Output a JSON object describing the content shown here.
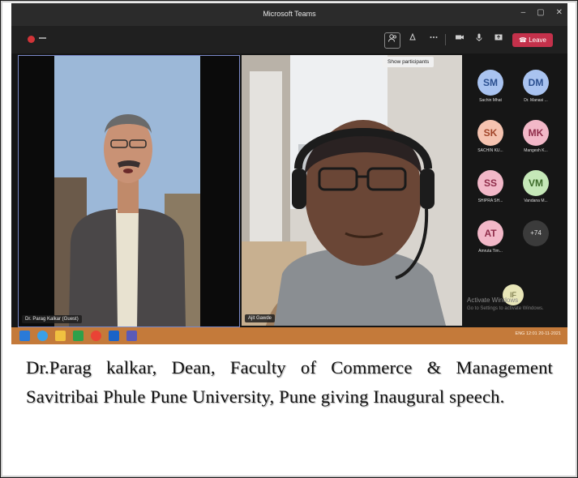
{
  "window": {
    "title": "Microsoft Teams",
    "controls": [
      "–",
      "▢",
      "✕"
    ]
  },
  "toolbar": {
    "show_participants_tooltip": "Show participants",
    "leave_label": "Leave",
    "icons": [
      "people-icon",
      "reactions-icon",
      "more-icon",
      "camera-icon",
      "mic-icon",
      "share-icon"
    ]
  },
  "stage": {
    "left_tile_name": "Dr. Parag Kalkar (Guest)",
    "right_tile_name": "Ajit Gawde"
  },
  "roster": [
    {
      "initials": "SM",
      "name": "Sachin Mhat",
      "bg": "#a9c3f0",
      "fg": "#2b4f8f"
    },
    {
      "initials": "DM",
      "name": "Dr. Manasi ...",
      "bg": "#a9c3f0",
      "fg": "#2b4f8f"
    },
    {
      "initials": "SK",
      "name": "SACHIN KU...",
      "bg": "#f5c3b0",
      "fg": "#a1462a"
    },
    {
      "initials": "MK",
      "name": "Mangesh K...",
      "bg": "#f2b8c8",
      "fg": "#8f2d4a"
    },
    {
      "initials": "SS",
      "name": "SHIPRA SH...",
      "bg": "#f2b8c8",
      "fg": "#8f2d4a"
    },
    {
      "initials": "VM",
      "name": "Vandana M...",
      "bg": "#c5e8b8",
      "fg": "#3d6b2a"
    },
    {
      "initials": "AT",
      "name": "Amruta Tim...",
      "bg": "#f2b8c8",
      "fg": "#8f2d4a"
    },
    {
      "initials": "+74",
      "name": "",
      "bg": "#3b3b3b",
      "fg": "#e0e0e0"
    }
  ],
  "overlay": {
    "watermark": "Activate Windows",
    "watermark_sub": "Go to Settings to activate Windows.",
    "if_initials": "IF"
  },
  "taskbar": {
    "tray_text": "ENG  12:01  20-11-2021"
  },
  "caption": {
    "text": "Dr.Parag kalkar, Dean, Faculty of Commerce & Management Savitribai Phule Pune University, Pune giving Inaugural speech."
  }
}
